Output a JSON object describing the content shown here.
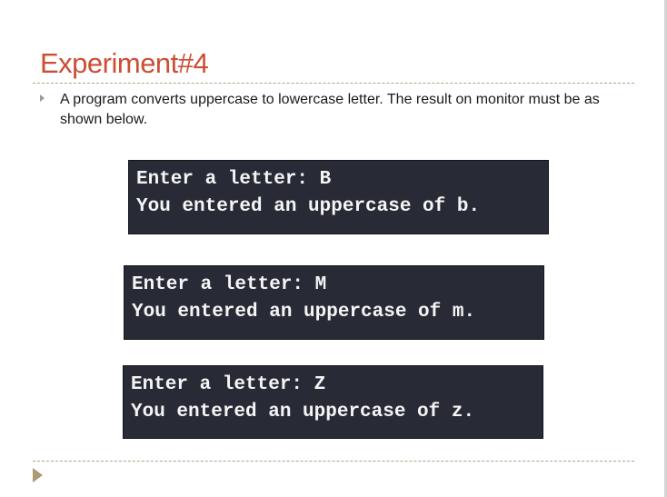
{
  "slide": {
    "title": "Experiment#4",
    "bullet": "A program converts uppercase to lowercase letter. The result on monitor must be as shown below."
  },
  "terminals": [
    {
      "prompt": "Enter a letter: B",
      "output": "You entered an uppercase of b."
    },
    {
      "prompt": "Enter a letter: M",
      "output": "You entered an uppercase of m."
    },
    {
      "prompt": "Enter a letter: Z",
      "output": "You entered an uppercase of z."
    }
  ],
  "colors": {
    "title": "#cc4e35",
    "terminal_bg": "#282a36",
    "terminal_text": "#f5f5f5",
    "rule": "#b4a089",
    "nav_arrow": "#ab9a72"
  },
  "icons": {
    "bullet": "triangle-right-icon",
    "navigation": "next-slide-icon"
  }
}
